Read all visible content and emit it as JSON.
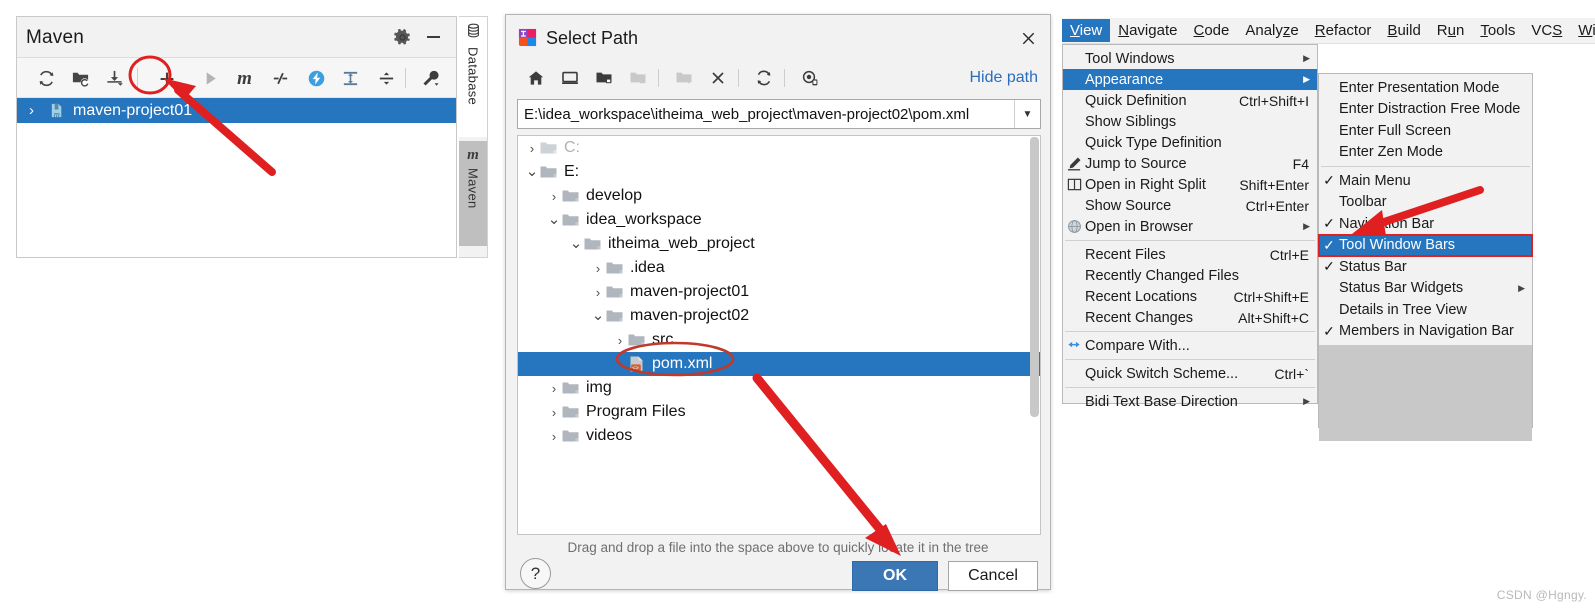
{
  "maven_panel": {
    "title": "Maven",
    "titlebar_icons": [
      "gear-icon",
      "minimize-icon"
    ],
    "toolbar_icons": [
      "reload-icon",
      "add-managed-project-icon",
      "download-sources-icon",
      "add-plus-icon",
      "run-icon",
      "maven-m-icon",
      "toggle-skip-tests-icon",
      "execute-goal-icon",
      "expand-all-icon",
      "collapse-all-icon",
      "settings-wrench-icon"
    ],
    "tree": [
      {
        "label": "maven-project01",
        "icon": "maven-module-icon",
        "chevron": "›",
        "selected": true
      }
    ]
  },
  "tool_window_bars": [
    {
      "label": "Database",
      "icon": "database-icon",
      "active": false
    },
    {
      "label": "Maven",
      "icon": "maven-m-icon",
      "active": true
    }
  ],
  "select_path_dialog": {
    "title": "Select Path",
    "app_icon": "intellij-idea-icon",
    "close_icon": "close-icon",
    "toolbar_icons": [
      "home-icon",
      "desktop-icon",
      "project-folder-icon",
      "module-folder-icon",
      "new-folder-icon",
      "delete-icon",
      "refresh-icon",
      "show-hidden-icon"
    ],
    "hide_path_label": "Hide path",
    "path_value": "E:\\idea_workspace\\itheima_web_project\\maven-project02\\pom.xml",
    "path_dropdown_icon": "chevron-down-icon",
    "tree": [
      {
        "label": "C:",
        "indent": 0,
        "chevron": "›",
        "icon": "folder-icon",
        "dim": true,
        "selected": false
      },
      {
        "label": "E:",
        "indent": 0,
        "chevron": "⌄",
        "icon": "folder-icon",
        "dim": false,
        "selected": false
      },
      {
        "label": "develop",
        "indent": 1,
        "chevron": "›",
        "icon": "folder-icon",
        "dim": false,
        "selected": false
      },
      {
        "label": "idea_workspace",
        "indent": 1,
        "chevron": "⌄",
        "icon": "folder-icon",
        "dim": false,
        "selected": false
      },
      {
        "label": "itheima_web_project",
        "indent": 2,
        "chevron": "⌄",
        "icon": "folder-icon",
        "dim": false,
        "selected": false
      },
      {
        "label": ".idea",
        "indent": 3,
        "chevron": "›",
        "icon": "folder-icon",
        "dim": false,
        "selected": false
      },
      {
        "label": "maven-project01",
        "indent": 3,
        "chevron": "›",
        "icon": "folder-icon",
        "dim": false,
        "selected": false
      },
      {
        "label": "maven-project02",
        "indent": 3,
        "chevron": "⌄",
        "icon": "folder-icon",
        "dim": false,
        "selected": false
      },
      {
        "label": "src",
        "indent": 4,
        "chevron": "›",
        "icon": "folder-icon",
        "dim": false,
        "selected": false
      },
      {
        "label": "pom.xml",
        "indent": 4,
        "chevron": "",
        "icon": "xml-file-icon",
        "dim": false,
        "selected": true
      },
      {
        "label": "img",
        "indent": 1,
        "chevron": "›",
        "icon": "folder-icon",
        "dim": false,
        "selected": false
      },
      {
        "label": "Program Files",
        "indent": 1,
        "chevron": "›",
        "icon": "folder-icon",
        "dim": false,
        "selected": false
      },
      {
        "label": "videos",
        "indent": 1,
        "chevron": "›",
        "icon": "folder-icon",
        "dim": false,
        "selected": false
      }
    ],
    "drag_hint": "Drag and drop a file into the space above to quickly locate it in the tree",
    "help_label": "?",
    "ok_label": "OK",
    "cancel_label": "Cancel"
  },
  "idea_menu": {
    "menubar": [
      {
        "label": "View",
        "mnemonic": "V",
        "active": true
      },
      {
        "label": "Navigate",
        "mnemonic": "N",
        "active": false
      },
      {
        "label": "Code",
        "mnemonic": "C",
        "active": false
      },
      {
        "label": "Analyze",
        "mnemonic": "z",
        "active": false
      },
      {
        "label": "Refactor",
        "mnemonic": "R",
        "active": false
      },
      {
        "label": "Build",
        "mnemonic": "B",
        "active": false
      },
      {
        "label": "Run",
        "mnemonic": "u",
        "active": false
      },
      {
        "label": "Tools",
        "mnemonic": "T",
        "active": false
      },
      {
        "label": "VCS",
        "mnemonic": "S",
        "active": false
      },
      {
        "label": "Win",
        "mnemonic": "W",
        "active": false
      }
    ],
    "view_menu": [
      {
        "label": "Tool Windows",
        "shortcut": "",
        "icon": "",
        "submenu": true,
        "highlight": false
      },
      {
        "label": "Appearance",
        "shortcut": "",
        "icon": "",
        "submenu": true,
        "highlight": true
      },
      {
        "label": "Quick Definition",
        "shortcut": "Ctrl+Shift+I",
        "icon": "",
        "submenu": false,
        "highlight": false
      },
      {
        "label": "Show Siblings",
        "shortcut": "",
        "icon": "",
        "submenu": false,
        "highlight": false
      },
      {
        "label": "Quick Type Definition",
        "shortcut": "",
        "icon": "",
        "submenu": false,
        "highlight": false
      },
      {
        "label": "Jump to Source",
        "shortcut": "F4",
        "icon": "pencil-icon",
        "submenu": false,
        "highlight": false
      },
      {
        "label": "Open in Right Split",
        "shortcut": "Shift+Enter",
        "icon": "split-pane-icon",
        "submenu": false,
        "highlight": false
      },
      {
        "label": "Show Source",
        "shortcut": "Ctrl+Enter",
        "icon": "",
        "submenu": false,
        "highlight": false
      },
      {
        "label": "Open in Browser",
        "shortcut": "",
        "icon": "globe-icon",
        "submenu": true,
        "highlight": false
      },
      {
        "separator": true
      },
      {
        "label": "Recent Files",
        "shortcut": "Ctrl+E",
        "icon": "",
        "submenu": false,
        "highlight": false
      },
      {
        "label": "Recently Changed Files",
        "shortcut": "",
        "icon": "",
        "submenu": false,
        "highlight": false
      },
      {
        "label": "Recent Locations",
        "shortcut": "Ctrl+Shift+E",
        "icon": "",
        "submenu": false,
        "highlight": false
      },
      {
        "label": "Recent Changes",
        "shortcut": "Alt+Shift+C",
        "icon": "",
        "submenu": false,
        "highlight": false
      },
      {
        "separator": true
      },
      {
        "label": "Compare With...",
        "shortcut": "",
        "icon": "compare-icon",
        "submenu": false,
        "highlight": false
      },
      {
        "separator": true
      },
      {
        "label": "Quick Switch Scheme...",
        "shortcut": "Ctrl+`",
        "icon": "",
        "submenu": false,
        "highlight": false
      },
      {
        "separator": true
      },
      {
        "label": "Bidi Text Base Direction",
        "shortcut": "",
        "icon": "",
        "submenu": true,
        "highlight": false
      }
    ],
    "appearance_submenu": [
      {
        "label": "Enter Presentation Mode",
        "checked": false
      },
      {
        "label": "Enter Distraction Free Mode",
        "checked": false
      },
      {
        "label": "Enter Full Screen",
        "checked": false
      },
      {
        "label": "Enter Zen Mode",
        "checked": false
      },
      {
        "separator": true
      },
      {
        "label": "Main Menu",
        "checked": true
      },
      {
        "label": "Toolbar",
        "checked": false
      },
      {
        "label": "Navigation Bar",
        "checked": true
      },
      {
        "label": "Tool Window Bars",
        "checked": true,
        "highlight": true,
        "outlined": true
      },
      {
        "label": "Status Bar",
        "checked": true
      },
      {
        "label": "Status Bar Widgets",
        "checked": false,
        "submenu": true
      },
      {
        "label": "Details in Tree View",
        "checked": false
      },
      {
        "label": "Members in Navigation Bar",
        "checked": true
      }
    ]
  },
  "annotations": {
    "circle_plus": "red-ellipse-around-add-button",
    "circle_pom": "red-ellipse-around-pom-xml",
    "arrow_to_plus": "red-arrow-pointing-to-add-button",
    "arrow_to_ok": "red-arrow-pointing-to-ok-button",
    "arrow_to_toolwindowbars": "red-arrow-pointing-to-tool-window-bars",
    "highlight_color": "#e02020"
  },
  "watermark": "CSDN @Hgngy."
}
